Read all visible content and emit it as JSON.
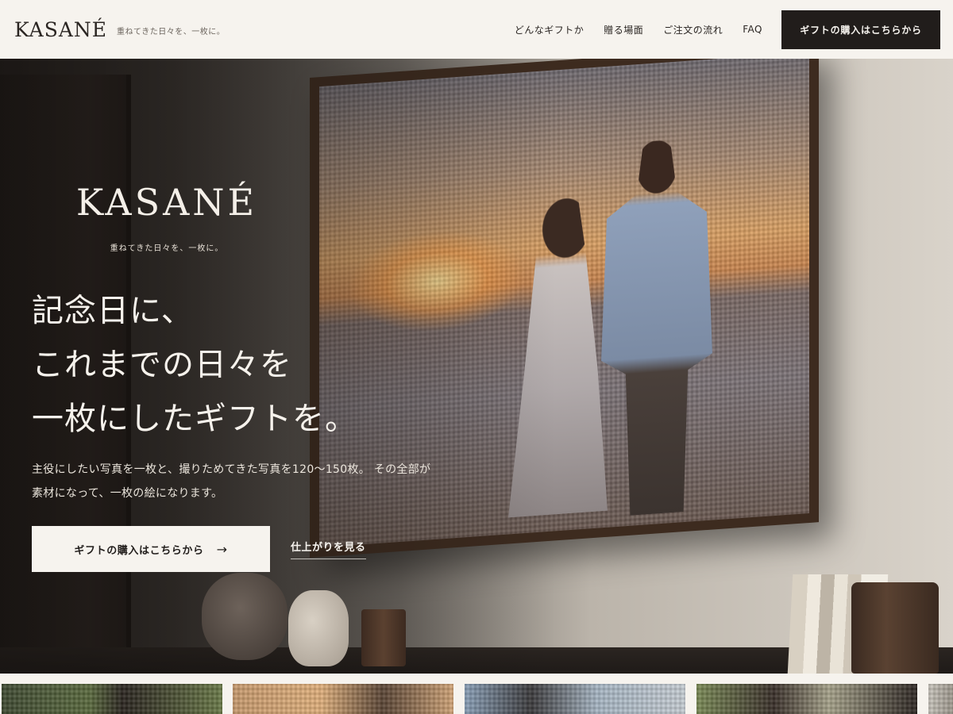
{
  "header": {
    "brand": "KASANÉ",
    "tagline": "重ねてきた日々を、一枚に。",
    "nav": [
      {
        "label": "どんなギフトか"
      },
      {
        "label": "贈る場面"
      },
      {
        "label": "ご注文の流れ"
      },
      {
        "label": "FAQ"
      }
    ],
    "cta_label": "ギフトの購入はこちらから"
  },
  "hero": {
    "logo": "KASANÉ",
    "logo_tagline": "重ねてきた日々を、一枚に。",
    "headline": [
      "記念日に、",
      "これまでの日々を",
      "一枚にしたギフトを。"
    ],
    "description": [
      "主役にしたい写真を一枚と、撮りためてきた写真を120〜150枚。 その全部が",
      "素材になって、一枚の絵になります。"
    ],
    "cta_label": "ギフトの購入はこちらから",
    "cta_arrow": "→",
    "link_label": "仕上がりを見る"
  },
  "colors": {
    "background": "#f6f3ee",
    "dark_button": "#211d1b",
    "frame": "#3d2b1f"
  }
}
